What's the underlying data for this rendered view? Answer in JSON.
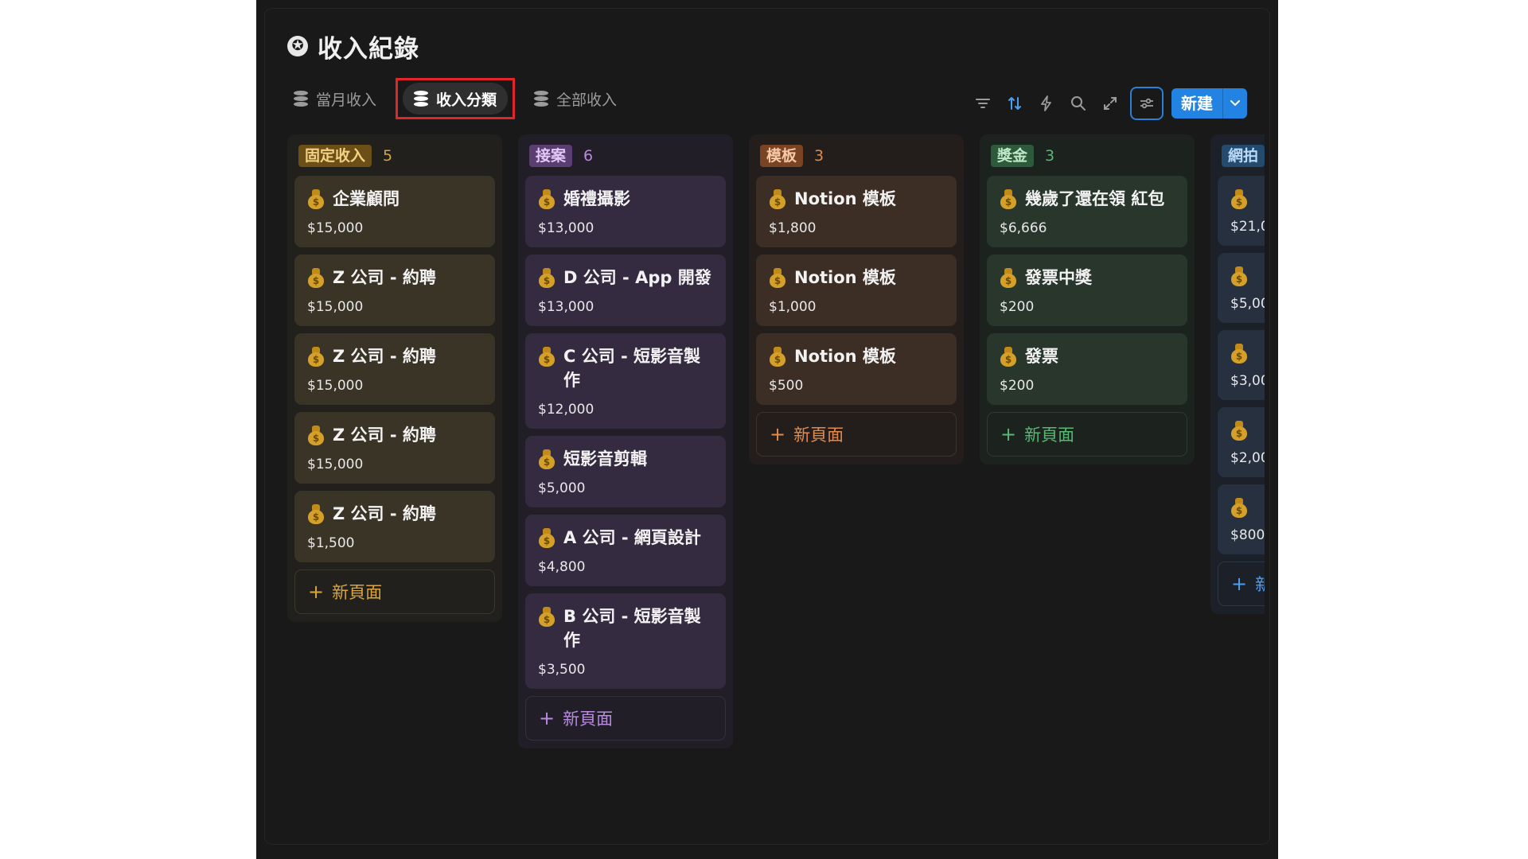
{
  "header": {
    "title": "收入紀錄",
    "icon": "star-circle-icon"
  },
  "tabs": [
    {
      "label": "當月收入",
      "active": false
    },
    {
      "label": "收入分類",
      "active": true
    },
    {
      "label": "全部收入",
      "active": false
    }
  ],
  "toolbar": {
    "new_label": "新建"
  },
  "columns": [
    {
      "tag": "固定收入",
      "count": "5",
      "tag_bg": "#6b4f16",
      "tag_fg": "#f3d184",
      "count_color": "#d9a53c",
      "col_bg": "#21201c",
      "card_bg": "#3a3427",
      "add_color": "#d9a53c",
      "add_border": "#3b372c",
      "cards": [
        {
          "title": "企業顧問",
          "amount": "$15,000"
        },
        {
          "title": "Z 公司 - 約聘",
          "amount": "$15,000"
        },
        {
          "title": "Z 公司 - 約聘",
          "amount": "$15,000"
        },
        {
          "title": "Z 公司 - 約聘",
          "amount": "$15,000"
        },
        {
          "title": "Z 公司 - 約聘",
          "amount": "$1,500"
        }
      ],
      "add_label": "新頁面"
    },
    {
      "tag": "接案",
      "count": "6",
      "tag_bg": "#5a3e72",
      "tag_fg": "#e3c8f7",
      "count_color": "#b78ae0",
      "col_bg": "#221e27",
      "card_bg": "#352b40",
      "add_color": "#b78ae0",
      "add_border": "#35303c",
      "cards": [
        {
          "title": "婚禮攝影",
          "amount": "$13,000"
        },
        {
          "title": "D 公司 - App 開發",
          "amount": "$13,000"
        },
        {
          "title": "C 公司 - 短影音製作",
          "amount": "$12,000"
        },
        {
          "title": "短影音剪輯",
          "amount": "$5,000"
        },
        {
          "title": "A 公司 - 網頁設計",
          "amount": "$4,800"
        },
        {
          "title": "B 公司 - 短影音製作",
          "amount": "$3,500"
        }
      ],
      "add_label": "新頁面"
    },
    {
      "tag": "模板",
      "count": "3",
      "tag_bg": "#7a4424",
      "tag_fg": "#f6c9a6",
      "count_color": "#e08a4e",
      "col_bg": "#231e1b",
      "card_bg": "#3d2e25",
      "add_color": "#e08a4e",
      "add_border": "#3c332d",
      "cards": [
        {
          "title": "Notion 模板",
          "amount": "$1,800"
        },
        {
          "title": "Notion 模板",
          "amount": "$1,000"
        },
        {
          "title": "Notion 模板",
          "amount": "$500"
        }
      ],
      "add_label": "新頁面"
    },
    {
      "tag": "獎金",
      "count": "3",
      "tag_bg": "#2e5a3c",
      "tag_fg": "#bfe7c8",
      "count_color": "#57b874",
      "col_bg": "#1c221e",
      "card_bg": "#28362c",
      "add_color": "#57b874",
      "add_border": "#2f3a32",
      "cards": [
        {
          "title": "幾歲了還在領 紅包",
          "amount": "$6,666"
        },
        {
          "title": "發票中獎",
          "amount": "$200"
        },
        {
          "title": "發票",
          "amount": "$200"
        }
      ],
      "add_label": "新頁面"
    },
    {
      "tag": "網拍",
      "count": "",
      "tag_bg": "#244a6e",
      "tag_fg": "#b9daf8",
      "count_color": "#4b9ff0",
      "col_bg": "#1b2029",
      "card_bg": "#26303e",
      "add_color": "#4b9ff0",
      "add_border": "#2d3643",
      "cards": [
        {
          "title": "",
          "amount": "$21,0"
        },
        {
          "title": "",
          "amount": "$5,00"
        },
        {
          "title": "",
          "amount": "$3,00"
        },
        {
          "title": "",
          "amount": "$2,00"
        },
        {
          "title": "",
          "amount": "$800"
        }
      ],
      "add_label": "新"
    }
  ]
}
